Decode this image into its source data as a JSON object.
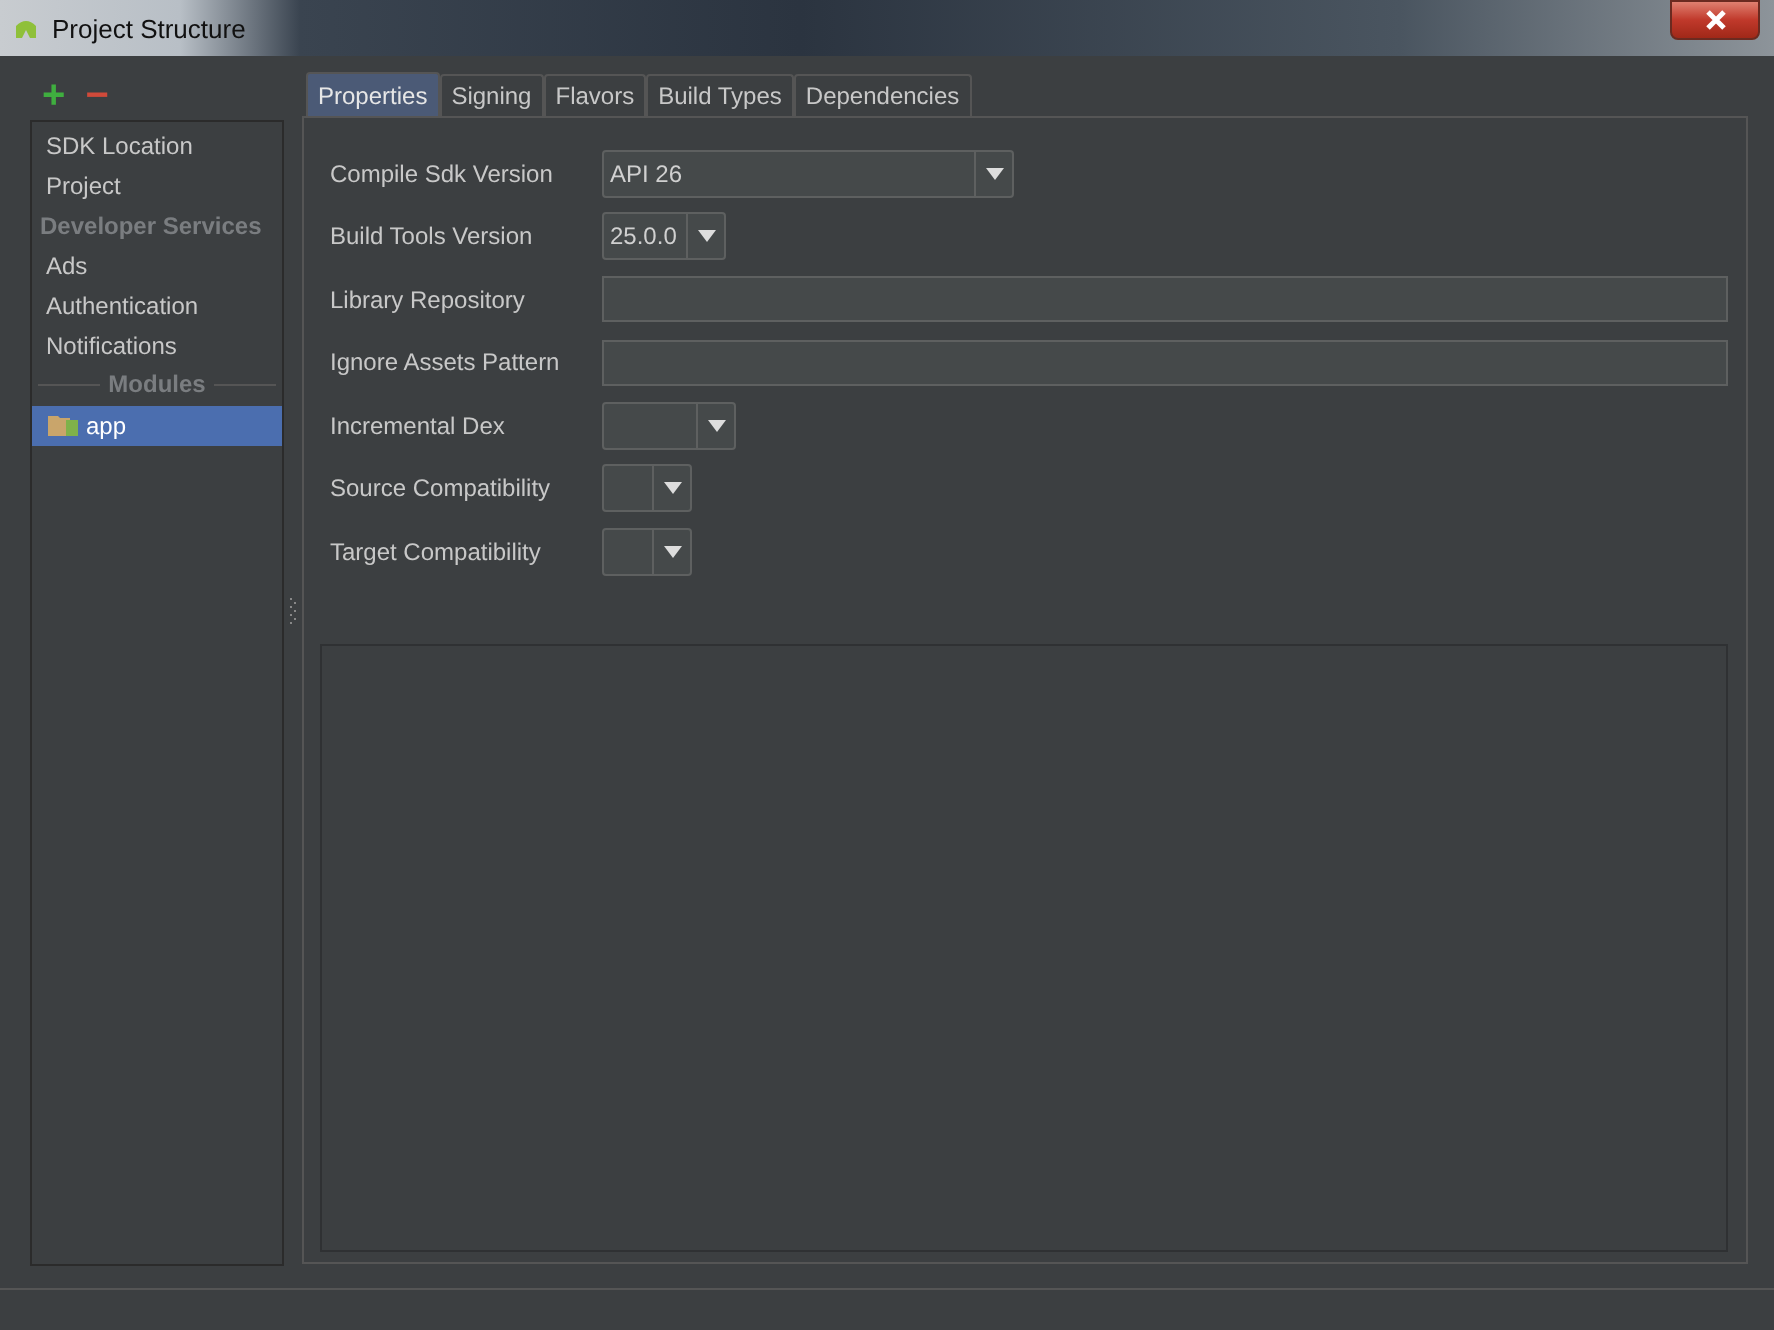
{
  "window": {
    "title": "Project Structure"
  },
  "toolbar": {
    "add": "+",
    "remove": "−"
  },
  "sidebar": {
    "items": [
      {
        "kind": "item",
        "label": "SDK Location",
        "selected": false
      },
      {
        "kind": "item",
        "label": "Project",
        "selected": false
      },
      {
        "kind": "header",
        "label": "Developer Services"
      },
      {
        "kind": "item",
        "label": "Ads",
        "selected": false
      },
      {
        "kind": "item",
        "label": "Authentication",
        "selected": false
      },
      {
        "kind": "item",
        "label": "Notifications",
        "selected": false
      },
      {
        "kind": "divider",
        "label": "Modules"
      },
      {
        "kind": "module",
        "label": "app",
        "selected": true
      }
    ]
  },
  "tabs": [
    {
      "label": "Properties",
      "selected": true
    },
    {
      "label": "Signing",
      "selected": false
    },
    {
      "label": "Flavors",
      "selected": false
    },
    {
      "label": "Build Types",
      "selected": false
    },
    {
      "label": "Dependencies",
      "selected": false
    }
  ],
  "properties": [
    {
      "kind": "combo",
      "label": "Compile Sdk Version",
      "value": "API 26"
    },
    {
      "kind": "combo",
      "label": "Build Tools Version",
      "value": "25.0.0"
    },
    {
      "kind": "text",
      "label": "Library Repository"
    },
    {
      "kind": "text",
      "label": "Ignore Assets Pattern"
    },
    {
      "kind": "combo",
      "label": "Incremental Dex"
    },
    {
      "kind": "combo",
      "label": "Source Compatibility"
    },
    {
      "kind": "combo",
      "label": "Target Compatibility"
    }
  ]
}
